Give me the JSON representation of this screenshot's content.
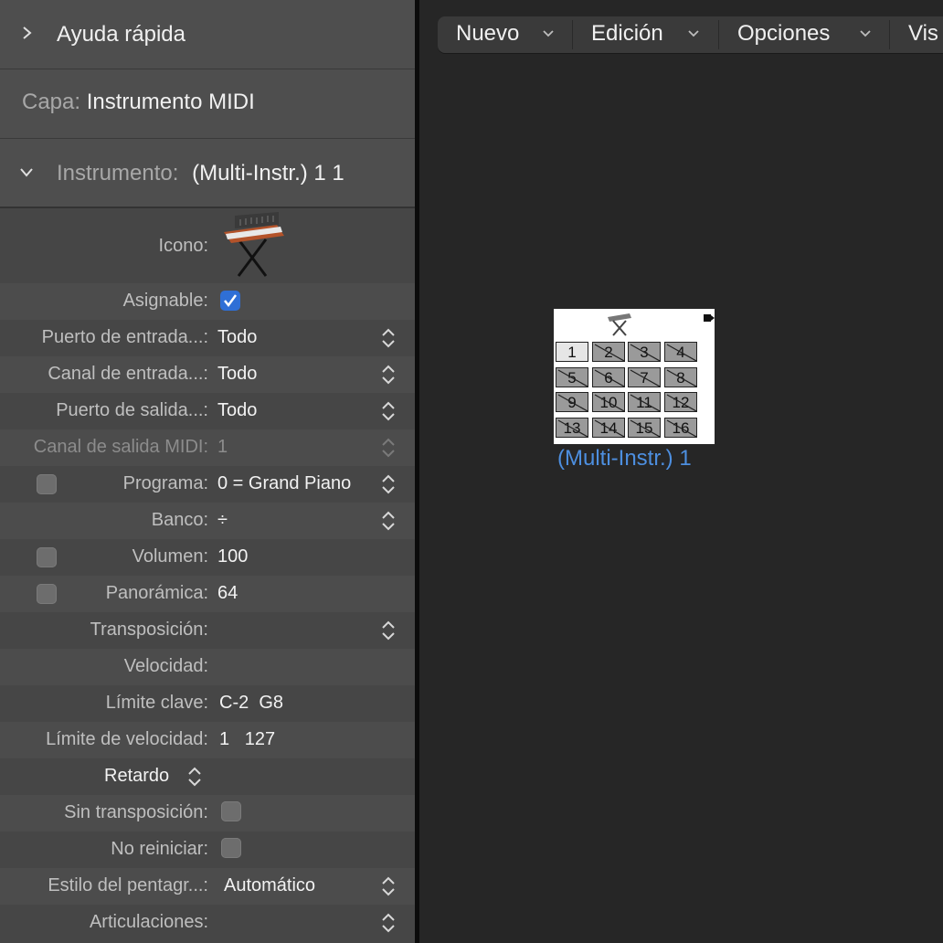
{
  "inspector": {
    "quick_help": "Ayuda rápida",
    "layer_key": "Capa:",
    "layer_value": "Instrumento MIDI",
    "instrument_key": "Instrumento:",
    "instrument_value": "(Multi-Instr.) 1 1",
    "rows": {
      "icono": "Icono:",
      "asignable": "Asignable:",
      "puerto_entrada": "Puerto de entrada...:",
      "puerto_entrada_val": "Todo",
      "canal_entrada": "Canal de entrada...:",
      "canal_entrada_val": "Todo",
      "puerto_salida": "Puerto de salida...:",
      "puerto_salida_val": "Todo",
      "canal_salida": "Canal de salida MIDI:",
      "canal_salida_val": "1",
      "programa": "Programa:",
      "programa_val": "0 = Grand Piano",
      "banco": "Banco:",
      "banco_val": "÷",
      "volumen": "Volumen:",
      "volumen_val": "100",
      "panoramica": "Panorámica:",
      "panoramica_val": "64",
      "transposicion": "Transposición:",
      "velocidad": "Velocidad:",
      "limite_clave": "Límite clave:",
      "limite_clave_val": "C-2  G8",
      "limite_velocidad": "Límite de velocidad:",
      "limite_velocidad_val": "1   127",
      "retardo": "Retardo",
      "sin_transposicion": "Sin transposición:",
      "no_reiniciar": "No reiniciar:",
      "estilo": "Estilo del pentagr...:",
      "estilo_val": "Automático",
      "articulaciones": "Articulaciones:"
    }
  },
  "toolbar": {
    "nuevo": "Nuevo",
    "edicion": "Edición",
    "opciones": "Opciones",
    "visualizacion": "Vis"
  },
  "object": {
    "name": "(Multi-Instr.) 1",
    "channels": [
      "1",
      "2",
      "3",
      "4",
      "5",
      "6",
      "7",
      "8",
      "9",
      "10",
      "11",
      "12",
      "13",
      "14",
      "15",
      "16"
    ]
  },
  "colors": {
    "accent_blue": "#2f6fd6",
    "object_label": "#4d8fe0"
  }
}
